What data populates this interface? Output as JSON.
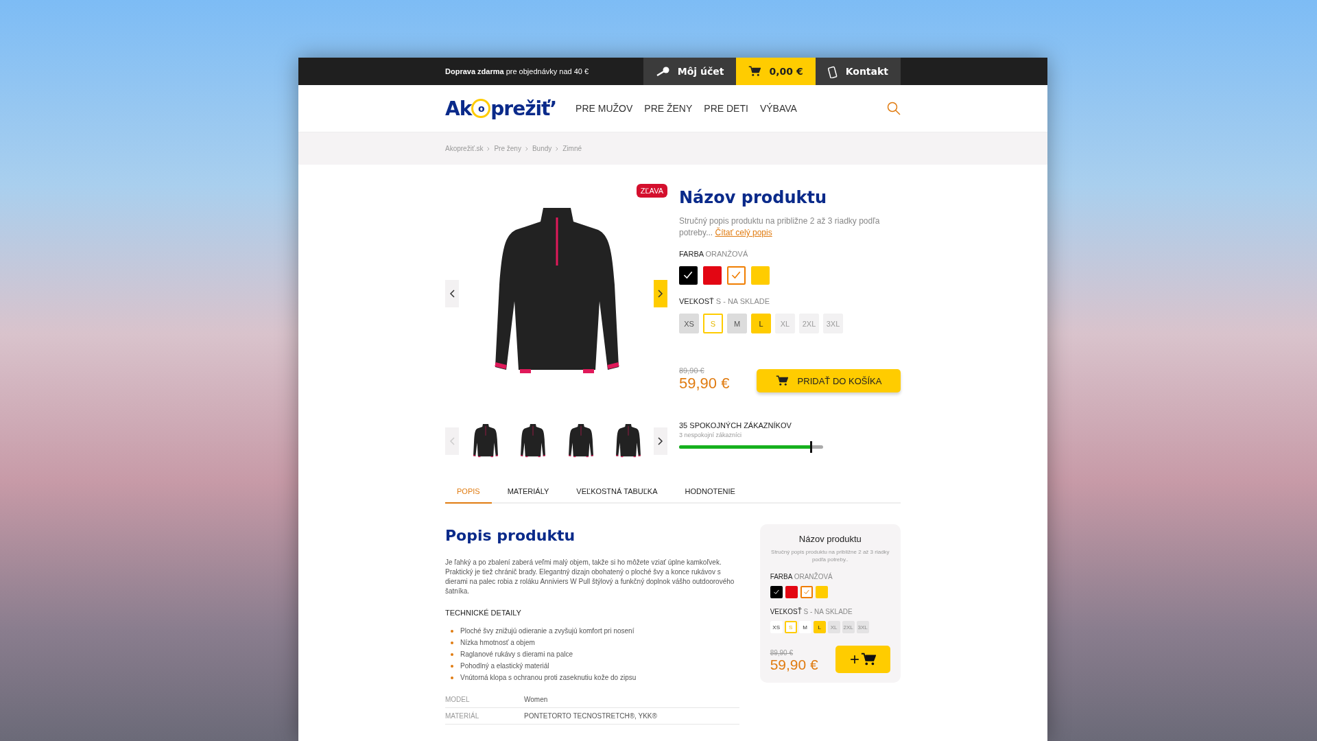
{
  "top_bar": {
    "shipping_note": "**Doprava  zdarma** pre objednávky nad 40 €",
    "account": "Môj účet",
    "cart_total": "0,00 €",
    "contact": "Kontakt"
  },
  "header": {
    "logo": {
      "before": "Ak",
      "mark": "o",
      "after": "prežiť’"
    },
    "nav": [
      "PRE MUŽOV",
      "PRE ŽENY",
      "PRE DETI",
      "VÝBAVA"
    ]
  },
  "breadcrumb": [
    "Akoprežiť.sk",
    "Pre ženy",
    "Bundy",
    "Zimné"
  ],
  "gallery": {
    "badge": "ZĽAVA",
    "thumbs_prev_disabled": true
  },
  "product": {
    "title": "Názov produktu",
    "summary": "Stručný popis produktu na približne 2 až 3 riadky podľa potreby...",
    "read_more": "Čítať celý popis",
    "color_label": "FARBA",
    "color_value": "ORANŽOVÁ",
    "colors": [
      {
        "color": "#000000",
        "checked": true,
        "selected": false
      },
      {
        "color": "#e30613",
        "checked": false,
        "selected": false
      },
      {
        "color": "#f07d00",
        "checked": true,
        "selected": true
      },
      {
        "color": "#ffcc00",
        "checked": false,
        "selected": false
      }
    ],
    "size_label": "VEĽKOSŤ",
    "size_value": "S - NA SKLADE",
    "sizes": [
      {
        "label": "XS",
        "kind": "available"
      },
      {
        "label": "S",
        "kind": "selected"
      },
      {
        "label": "M",
        "kind": "available"
      },
      {
        "label": "L",
        "kind": "active"
      },
      {
        "label": "XL",
        "kind": "unavailable"
      },
      {
        "label": "2XL",
        "kind": "unavailable"
      },
      {
        "label": "3XL",
        "kind": "unavailable"
      }
    ],
    "old_price": "89,90 €",
    "price": "59,90 €",
    "add_to_cart": "PRIDAŤ DO KOŠÍKA",
    "satisfaction": {
      "title": "35 SPOKOJNÝCH ZÁKAZNÍKOV",
      "subtitle": "3 nespokojní zákazníci",
      "level": 0.92
    }
  },
  "tabs": [
    {
      "label": "POPIS",
      "selected": true
    },
    {
      "label": "MATERIÁLY",
      "selected": false
    },
    {
      "label": "VEĽKOSTNÁ TABUĽKA",
      "selected": false
    },
    {
      "label": "HODNOTENIE",
      "selected": false
    }
  ],
  "description": {
    "title": "Popis produktu",
    "text": "Je ľahký a po zbalení zaberá veľmi malý objem, takže si ho môžete vziať úplne kamkoľvek. Praktický je tiež chránič brady. Elegantný dizajn obohatený o ploché švy a konce rukávov s dierami na palec robia z roláku Anniviers W Pull štýlový a funkčný doplnok vášho outdoorového šatníka.",
    "details_title": "TECHNICKÉ DETAILY",
    "details": [
      "Ploché švy znižujú odieranie a zvyšujú komfort pri nosení",
      "Nízka hmotnosť a objem",
      "Raglanové rukávy s dierami na palce",
      "Pohodlný a elastický materiál",
      "Vnútorná klopa s ochranou proti zaseknutiu kože do zipsu"
    ],
    "specs": [
      {
        "name": "MODEL",
        "value": "Women"
      },
      {
        "name": "MATERIÁL",
        "value": "PONTETORTO TECNOSTRETCH®, YKK®"
      }
    ]
  },
  "summary_card": {
    "title": "Názov produktu",
    "summary": "Stručný popis produktu na približne 2 až 3 riadky podľa potreby..",
    "color_label": "FARBA",
    "color_value": "ORANŽOVÁ",
    "colors": [
      {
        "color": "#000000",
        "checked": true,
        "selected": false
      },
      {
        "color": "#e30613",
        "checked": false,
        "selected": false
      },
      {
        "color": "#f07d00",
        "checked": true,
        "selected": true
      },
      {
        "color": "#ffcc00",
        "checked": false,
        "selected": false
      }
    ],
    "size_label": "VEĽKOSŤ",
    "size_value": "S - NA SKLADE",
    "sizes": [
      {
        "label": "XS",
        "kind": "available"
      },
      {
        "label": "S",
        "kind": "selected"
      },
      {
        "label": "M",
        "kind": "available"
      },
      {
        "label": "L",
        "kind": "active"
      },
      {
        "label": "XL",
        "kind": "unavailable"
      },
      {
        "label": "2XL",
        "kind": "unavailable"
      },
      {
        "label": "3XL",
        "kind": "unavailable"
      }
    ],
    "old_price": "89,90 €",
    "price": "59,90 €",
    "add_button": "+"
  }
}
